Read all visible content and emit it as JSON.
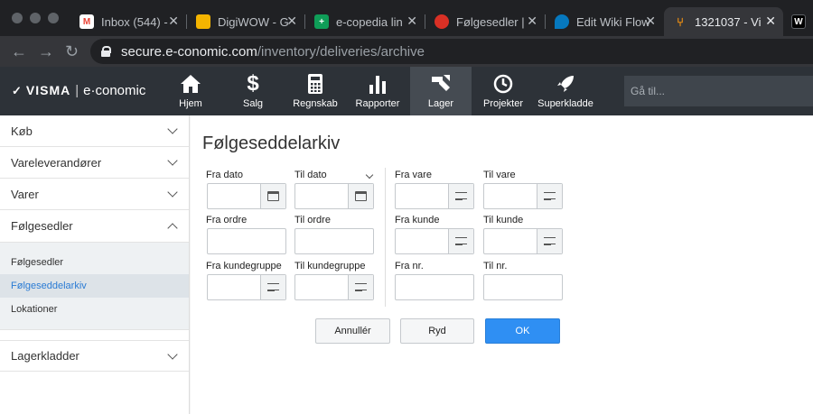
{
  "browser": {
    "tabs": [
      {
        "label": "Inbox (544) -",
        "icon": "gmail-icon",
        "color": "#ea4335"
      },
      {
        "label": "DigiWOW - G",
        "icon": "slides-icon",
        "color": "#f4b400"
      },
      {
        "label": "e-copedia lin",
        "icon": "sheets-icon",
        "color": "#0f9d58"
      },
      {
        "label": "Følgesedler |",
        "icon": "lips-icon",
        "color": "#d93025"
      },
      {
        "label": "Edit Wiki Flow",
        "icon": "drupal-icon",
        "color": "#0678be"
      },
      {
        "label": "1321037 - Vi",
        "icon": "git-icon",
        "color": "#f29111"
      },
      {
        "label": "W",
        "icon": "w-icon",
        "color": "#ffffff"
      }
    ],
    "close_glyph": "✕",
    "url_host": "secure.e-conomic.com",
    "url_path": "/inventory/deliveries/archive"
  },
  "app": {
    "logo_brand": "VISMA",
    "logo_sep": "|",
    "logo_product": "e·conomic",
    "nav": [
      {
        "label": "Hjem",
        "icon": "home-icon"
      },
      {
        "label": "Salg",
        "icon": "dollar-icon"
      },
      {
        "label": "Regnskab",
        "icon": "calculator-icon"
      },
      {
        "label": "Rapporter",
        "icon": "bar-chart-icon"
      },
      {
        "label": "Lager",
        "icon": "inventory-icon",
        "active": true
      },
      {
        "label": "Projekter",
        "icon": "clock-icon"
      },
      {
        "label": "Superkladde",
        "icon": "rocket-icon"
      }
    ],
    "search_placeholder": "Gå til..."
  },
  "sidebar": {
    "items": [
      {
        "label": "Køb"
      },
      {
        "label": "Vareleverandører"
      },
      {
        "label": "Varer"
      },
      {
        "label": "Følgesedler",
        "expanded": true
      }
    ],
    "subitems": [
      {
        "label": "Følgesedler"
      },
      {
        "label": "Følgeseddelarkiv",
        "active": true
      },
      {
        "label": "Lokationer"
      }
    ],
    "last_item": {
      "label": "Lagerkladder"
    }
  },
  "main": {
    "title": "Følgeseddelarkiv",
    "fields": {
      "fra_dato": {
        "label": "Fra dato",
        "value": ""
      },
      "til_dato": {
        "label": "Til dato",
        "value": ""
      },
      "fra_ordre": {
        "label": "Fra ordre",
        "value": ""
      },
      "til_ordre": {
        "label": "Til ordre",
        "value": ""
      },
      "fra_kundegruppe": {
        "label": "Fra kundegruppe",
        "value": ""
      },
      "til_kundegruppe": {
        "label": "Til kundegruppe",
        "value": ""
      },
      "fra_vare": {
        "label": "Fra vare",
        "value": ""
      },
      "til_vare": {
        "label": "Til vare",
        "value": ""
      },
      "fra_kunde": {
        "label": "Fra kunde",
        "value": ""
      },
      "til_kunde": {
        "label": "Til kunde",
        "value": ""
      },
      "fra_nr": {
        "label": "Fra nr.",
        "value": ""
      },
      "til_nr": {
        "label": "Til nr.",
        "value": ""
      }
    },
    "buttons": {
      "cancel": "Annullér",
      "clear": "Ryd",
      "ok": "OK"
    }
  },
  "colors": {
    "accent": "#2f8ff3",
    "active_link": "#2a7bd4",
    "header_bg": "#2d3238"
  }
}
